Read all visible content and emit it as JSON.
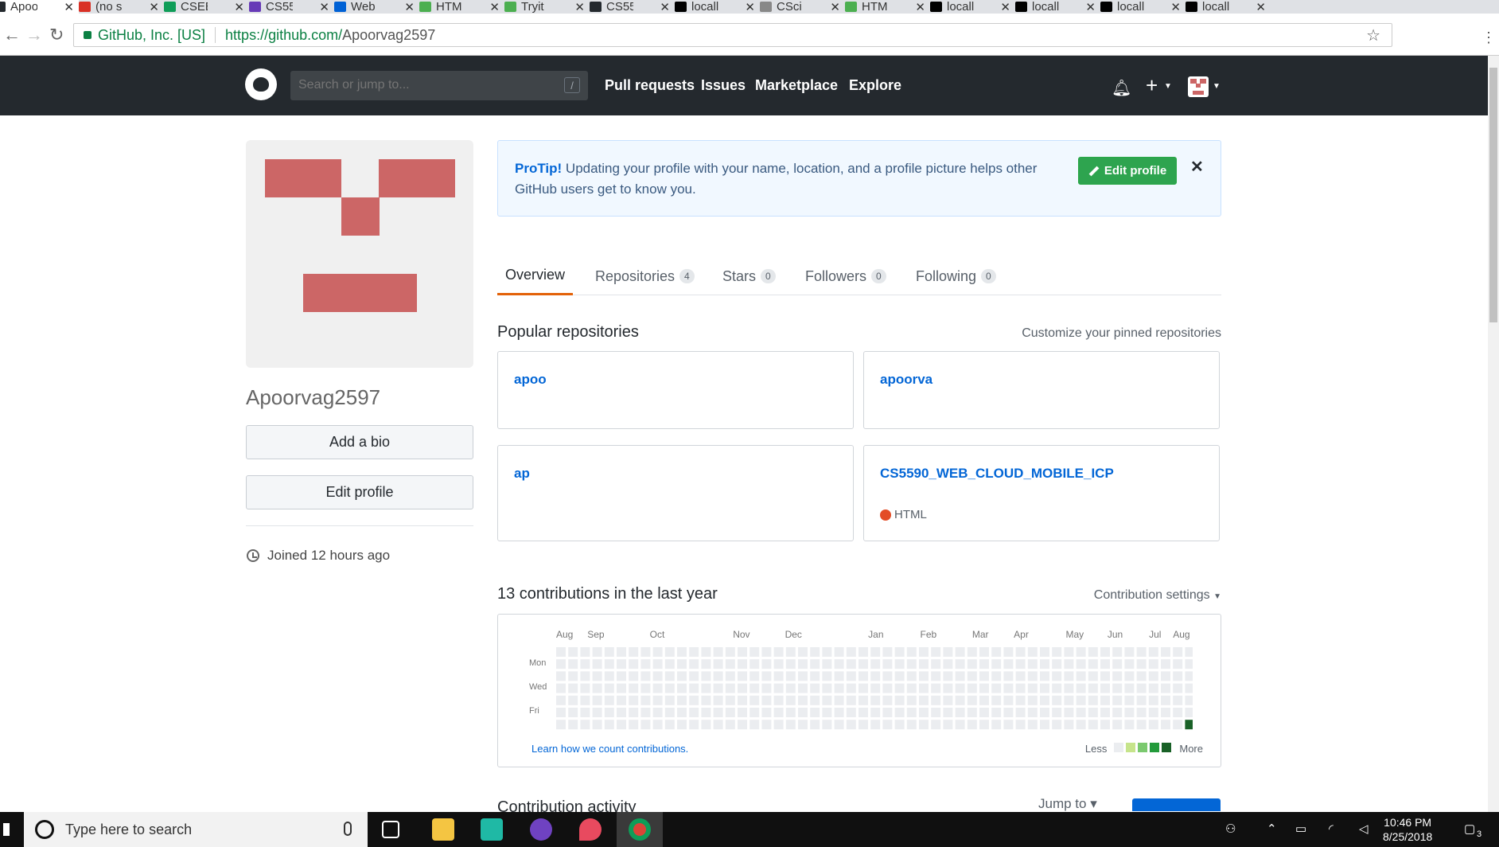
{
  "browser": {
    "tabs": [
      {
        "label": "Apoo",
        "favicon": "github-icon",
        "color": "#24292e"
      },
      {
        "label": "(no s",
        "favicon": "gmail-icon",
        "color": "#d93025"
      },
      {
        "label": "CSEE",
        "favicon": "sheets-icon",
        "color": "#0f9d58"
      },
      {
        "label": "CS55",
        "favicon": "forms-icon",
        "color": "#673ab7"
      },
      {
        "label": "Web",
        "favicon": "box-icon",
        "color": "#0061d5"
      },
      {
        "label": "HTM",
        "favicon": "w3-icon",
        "color": "#4caf50"
      },
      {
        "label": "Tryit",
        "favicon": "w3-icon",
        "color": "#4caf50"
      },
      {
        "label": "CS55",
        "favicon": "github-icon",
        "color": "#24292e"
      },
      {
        "label": "locall",
        "favicon": "webstorm-icon",
        "color": "#000000"
      },
      {
        "label": "CSci",
        "favicon": "database-icon",
        "color": "#888888"
      },
      {
        "label": "HTM",
        "favicon": "w3-icon",
        "color": "#4caf50"
      },
      {
        "label": "locall",
        "favicon": "webstorm-icon",
        "color": "#000000"
      },
      {
        "label": "locall",
        "favicon": "webstorm-icon",
        "color": "#000000"
      },
      {
        "label": "locall",
        "favicon": "webstorm-icon",
        "color": "#000000"
      },
      {
        "label": "locall",
        "favicon": "webstorm-icon",
        "color": "#000000"
      }
    ],
    "secure_label": "GitHub, Inc. [US]",
    "url_host": "https://github.com/",
    "url_path": "Apoorvag2597"
  },
  "header": {
    "search_placeholder": "Search or jump to...",
    "slash_key": "/",
    "nav": [
      "Pull requests",
      "Issues",
      "Marketplace",
      "Explore"
    ],
    "plus": "+"
  },
  "profile": {
    "username": "Apoorvag2597",
    "add_bio": "Add a bio",
    "edit_profile": "Edit profile",
    "joined": "Joined 12 hours ago",
    "avatar_color": "#cc6666"
  },
  "protip": {
    "strong": "ProTip!",
    "text": " Updating your profile with your name, location, and a profile picture helps other GitHub users get to know you.",
    "button": "Edit profile",
    "close": "✕"
  },
  "tabs": [
    {
      "label": "Overview",
      "count": null
    },
    {
      "label": "Repositories",
      "count": "4"
    },
    {
      "label": "Stars",
      "count": "0"
    },
    {
      "label": "Followers",
      "count": "0"
    },
    {
      "label": "Following",
      "count": "0"
    }
  ],
  "popular": {
    "title": "Popular repositories",
    "customize": "Customize your pinned repositories",
    "repos": [
      {
        "name": "apoo",
        "language": ""
      },
      {
        "name": "apoorva",
        "language": ""
      },
      {
        "name": "ap",
        "language": ""
      },
      {
        "name": "CS5590_WEB_CLOUD_MOBILE_ICP",
        "language": "HTML"
      }
    ]
  },
  "contributions": {
    "title": "13 contributions in the last year",
    "settings": "Contribution settings",
    "months": [
      "Aug",
      "Sep",
      "Oct",
      "Nov",
      "Dec",
      "Jan",
      "Feb",
      "Mar",
      "Apr",
      "May",
      "Jun",
      "Jul",
      "Aug"
    ],
    "days": [
      "Mon",
      "Wed",
      "Fri"
    ],
    "weeks": 53,
    "active_cell": {
      "week": 52,
      "day": 6,
      "level": 4
    },
    "learn": "Learn how we count contributions.",
    "less": "Less",
    "more": "More",
    "legend_colors": [
      "#ebedf0",
      "#c6e48b",
      "#7bc96f",
      "#239a3b",
      "#196127"
    ]
  },
  "activity": {
    "title": "Contribution activity",
    "jump_to": "Jump to ▾"
  },
  "taskbar": {
    "search_placeholder": "Type here to search",
    "time": "10:46 PM",
    "date": "8/25/2018",
    "notifications": "3"
  }
}
